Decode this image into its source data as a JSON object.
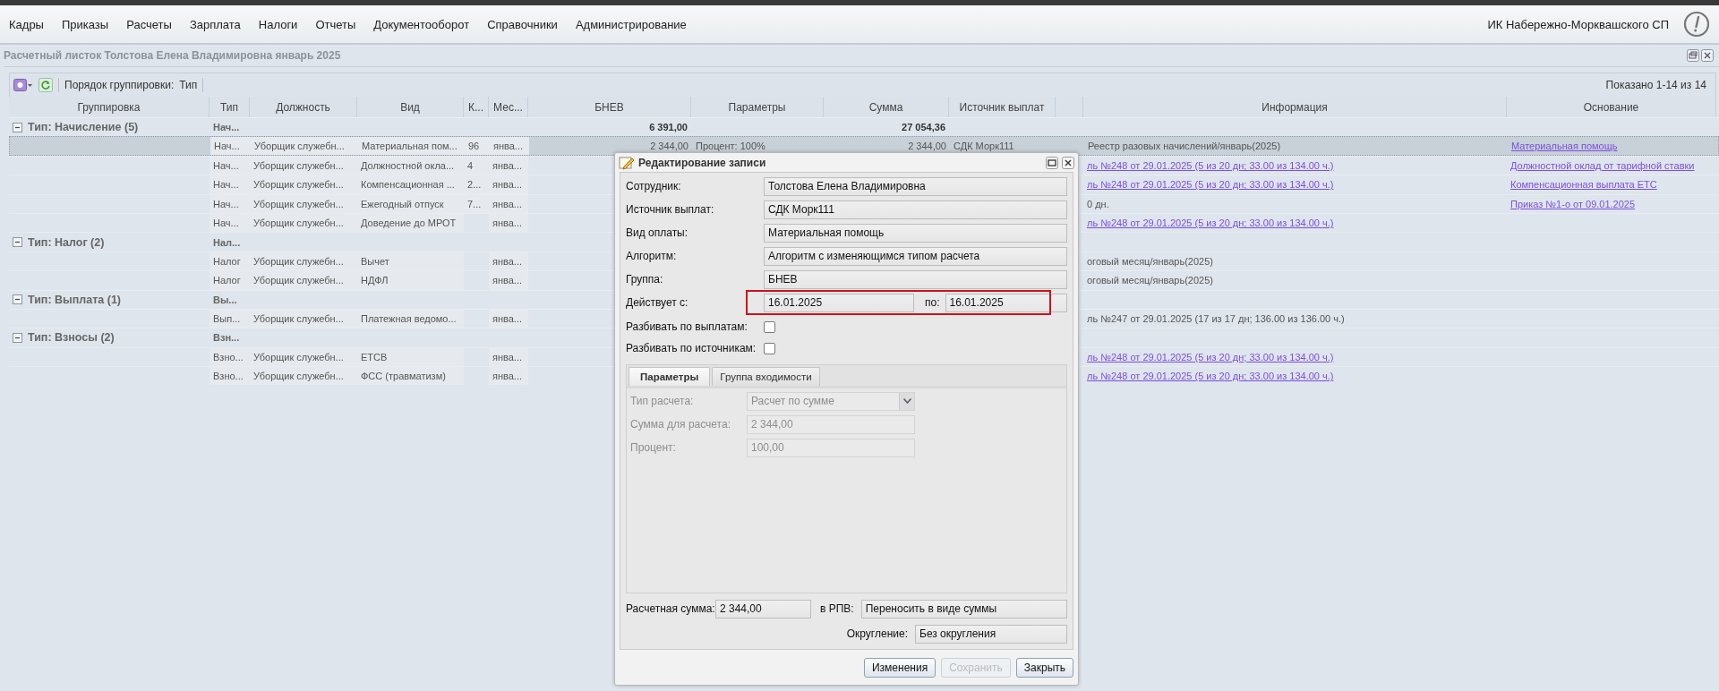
{
  "menu": [
    "Кадры",
    "Приказы",
    "Расчеты",
    "Зарплата",
    "Налоги",
    "Отчеты",
    "Документооборот",
    "Справочники",
    "Администрирование"
  ],
  "org_name": "ИК Набережно-Морквашского СП",
  "panel": {
    "title": "Расчетный листок Толстова Елена Владимировна январь 2025",
    "grouping_label": "Порядок группировки:",
    "grouping_value": "Тип",
    "shown": "Показано 1-14 из 14"
  },
  "table": {
    "columns": [
      "Группировка",
      "Тип",
      "Должность",
      "Вид",
      "К...",
      "Мес...",
      "БНЕВ",
      "Параметры",
      "Сумма",
      "Источник выплат",
      "Информация",
      "Основание"
    ],
    "rows": [
      {
        "kind": "group",
        "selected": false,
        "expanded": true,
        "group": "Тип: Начисление (5)",
        "type": "Нач...",
        "bnev": "6 391,00",
        "sum": "27 054,36"
      },
      {
        "kind": "item",
        "selected": true,
        "type": "Нач...",
        "position": "Уборщик служебн...",
        "pay": "Материальная пом...",
        "k": "96",
        "month": "янва...",
        "bnev": "2 344,00",
        "params": "Процент: 100%",
        "sum": "2 344,00",
        "source": "СДК Морк111",
        "info": "Реестр разовых начислений/январь(2025)",
        "info_link": false,
        "basis": "Материальная помощь"
      },
      {
        "kind": "item",
        "selected": false,
        "type": "Нач...",
        "position": "Уборщик служебн...",
        "pay": "Должностной окла...",
        "k": "4",
        "month": "янва...",
        "info": "ль №248 от 29.01.2025 (5 из 20 дн; 33.00 из 134.00 ч.)",
        "info_link": true,
        "basis": "Должностной оклад от тарифной ставки"
      },
      {
        "kind": "item",
        "selected": false,
        "type": "Нач...",
        "position": "Уборщик служебн...",
        "pay": "Компенсационная ...",
        "k": "2...",
        "month": "янва...",
        "info": "ль №248 от 29.01.2025 (5 из 20 дн; 33.00 из 134.00 ч.)",
        "info_link": true,
        "basis": "Компенсационная выплата ЕТС"
      },
      {
        "kind": "item",
        "selected": false,
        "type": "Нач...",
        "position": "Уборщик служебн...",
        "pay": "Ежегодный отпуск",
        "k": "7...",
        "month": "янва...",
        "info": "0 дн.",
        "info_link": false,
        "basis": "Приказ №1-о от 09.01.2025"
      },
      {
        "kind": "item",
        "selected": false,
        "type": "Нач...",
        "position": "Уборщик служебн...",
        "pay": "Доведение до МРОТ",
        "month": "янва...",
        "info": "ль №248 от 29.01.2025 (5 из 20 дн; 33.00 из 134.00 ч.)",
        "info_link": true
      },
      {
        "kind": "group",
        "selected": false,
        "expanded": true,
        "group": "Тип: Налог (2)",
        "type": "Нал..."
      },
      {
        "kind": "item",
        "selected": false,
        "type": "Налог",
        "position": "Уборщик служебн...",
        "pay": "Вычет",
        "month": "янва...",
        "info": "оговый месяц/январь(2025)",
        "info_link": false
      },
      {
        "kind": "item",
        "selected": false,
        "type": "Налог",
        "position": "Уборщик служебн...",
        "pay": "НДФЛ",
        "month": "янва...",
        "info": "оговый месяц/январь(2025)",
        "info_link": false
      },
      {
        "kind": "group",
        "selected": false,
        "expanded": true,
        "group": "Тип: Выплата (1)",
        "type": "Вы..."
      },
      {
        "kind": "item",
        "selected": false,
        "type": "Вып...",
        "position": "Уборщик служебн...",
        "pay": "Платежная ведомо...",
        "month": "янва...",
        "info": "ль №247 от 29.01.2025 (17 из 17 дн; 136.00 из 136.00 ч.)",
        "info_link": false
      },
      {
        "kind": "group",
        "selected": false,
        "expanded": true,
        "group": "Тип: Взносы (2)",
        "type": "Взн..."
      },
      {
        "kind": "item",
        "selected": false,
        "type": "Взно...",
        "position": "Уборщик служебн...",
        "pay": "ЕТСВ",
        "month": "янва...",
        "info": "ль №248 от 29.01.2025 (5 из 20 дн; 33.00 из 134.00 ч.)",
        "info_link": true
      },
      {
        "kind": "item",
        "selected": false,
        "type": "Взно...",
        "position": "Уборщик служебн...",
        "pay": "ФСС (травматизм)",
        "month": "янва...",
        "info": "ль №248 от 29.01.2025 (5 из 20 дн; 33.00 из 134.00 ч.)",
        "info_link": true
      }
    ]
  },
  "dialog": {
    "title": "Редактирование записи",
    "fields": [
      {
        "label": "Сотрудник:",
        "value": "Толстова Елена Владимировна"
      },
      {
        "label": "Источник выплат:",
        "value": "СДК Морк111"
      },
      {
        "label": "Вид оплаты:",
        "value": "Материальная помощь"
      },
      {
        "label": "Алгоритм:",
        "value": "Алгоритм с изменяющимся типом расчета"
      },
      {
        "label": "Группа:",
        "value": "БНЕВ"
      }
    ],
    "dates": {
      "label": "Действует с:",
      "from": "16.01.2025",
      "to_label": "по:",
      "to": "16.01.2025",
      "highlighted": true
    },
    "checkboxes": [
      {
        "label": "Разбивать по выплатам:",
        "checked": false
      },
      {
        "label": "Разбивать по источникам:",
        "checked": false
      }
    ],
    "tabs": [
      {
        "label": "Параметры",
        "selected": true
      },
      {
        "label": "Группа входимости",
        "selected": false
      }
    ],
    "params": [
      {
        "kind": "select",
        "label": "Тип расчета:",
        "value": "Расчет по сумме",
        "disabled": true
      },
      {
        "kind": "text",
        "label": "Сумма для расчета:",
        "value": "2 344,00",
        "disabled": true
      },
      {
        "kind": "text",
        "label": "Процент:",
        "value": "100,00",
        "disabled": true
      }
    ],
    "calc_sum": {
      "label": "Расчетная сумма:",
      "value": "2 344,00"
    },
    "rpv": {
      "label": "в РПВ:",
      "value": "Переносить в виде суммы"
    },
    "rounding": {
      "label": "Округление:",
      "value": "Без округления"
    },
    "buttons": [
      {
        "label": "Изменения",
        "disabled": false
      },
      {
        "label": "Сохранить",
        "disabled": true
      },
      {
        "label": "Закрыть",
        "disabled": false
      }
    ]
  }
}
